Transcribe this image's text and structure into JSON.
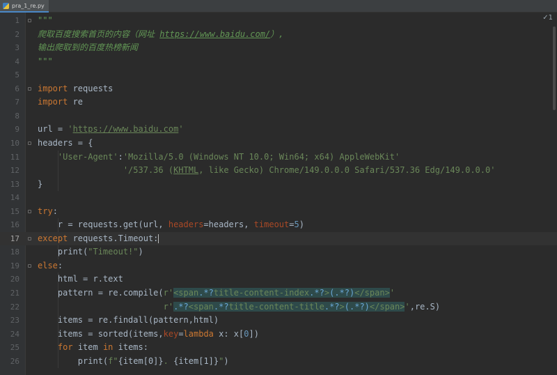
{
  "tab": {
    "label": "pra_1_re.py",
    "icon": "python-file-icon"
  },
  "inspection": {
    "text": "✓1"
  },
  "current_line": 17,
  "lines": [
    {
      "n": "1",
      "c": "\"\"\""
    },
    {
      "n": "2",
      "c": "爬取百度搜索首页的内容（网址 https://www.baidu.com/）,"
    },
    {
      "n": "3",
      "c": "输出爬取到的百度热榜新闻"
    },
    {
      "n": "4",
      "c": "\"\"\""
    },
    {
      "n": "5",
      "c": ""
    },
    {
      "n": "6",
      "c": "import requests"
    },
    {
      "n": "7",
      "c": "import re"
    },
    {
      "n": "8",
      "c": ""
    },
    {
      "n": "9",
      "c": "url = 'https://www.baidu.com'"
    },
    {
      "n": "10",
      "c": "headers = {"
    },
    {
      "n": "11",
      "c": "    'User-Agent':'Mozilla/5.0 (Windows NT 10.0; Win64; x64) AppleWebKit'"
    },
    {
      "n": "12",
      "c": "                 '/537.36 (KHTML, like Gecko) Chrome/149.0.0.0 Safari/537.36 Edg/149.0.0.0'"
    },
    {
      "n": "13",
      "c": "}"
    },
    {
      "n": "14",
      "c": ""
    },
    {
      "n": "15",
      "c": "try:"
    },
    {
      "n": "16",
      "c": "    r = requests.get(url, headers=headers, timeout=5)"
    },
    {
      "n": "17",
      "c": "except requests.Timeout:"
    },
    {
      "n": "18",
      "c": "    print(\"Timeout!\")"
    },
    {
      "n": "19",
      "c": "else:"
    },
    {
      "n": "20",
      "c": "    html = r.text"
    },
    {
      "n": "21",
      "c": "    pattern = re.compile(r'<span.*?title-content-index.*?>(.*?)</span>'"
    },
    {
      "n": "22",
      "c": "                         r'.*?<span.*?title-content-title.*?>(.*?)</span>',re.S)"
    },
    {
      "n": "23",
      "c": "    items = re.findall(pattern,html)"
    },
    {
      "n": "24",
      "c": "    items = sorted(items,key=lambda x: x[0])"
    },
    {
      "n": "25",
      "c": "    for item in items:"
    },
    {
      "n": "26",
      "c": "        print(f\"{item[0]}. {item[1]}\")"
    }
  ],
  "colors": {
    "background": "#2b2b2b",
    "keyword": "#cc7832",
    "string": "#6a8759",
    "docstring": "#629755",
    "parameter": "#aa4926",
    "number": "#6897bb",
    "identifier": "#a9b7c6",
    "line_number": "#606366"
  }
}
